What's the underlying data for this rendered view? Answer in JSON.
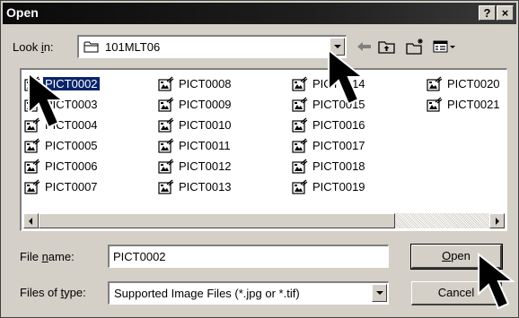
{
  "window": {
    "title": "Open",
    "help_label": "?",
    "close_label": "×"
  },
  "lookin": {
    "label_pre": "Look ",
    "label_ul": "i",
    "label_post": "n:",
    "value": "101MLT06"
  },
  "toolbar": {
    "back_icon": "back-arrow-icon",
    "up_icon": "up-one-level-icon",
    "new_folder_icon": "new-folder-icon",
    "view_icon": "view-menu-icon"
  },
  "files": [
    [
      "PICT0002",
      "PICT0003",
      "PICT0004",
      "PICT0005",
      "PICT0006",
      "PICT0007"
    ],
    [
      "PICT0008",
      "PICT0009",
      "PICT0010",
      "PICT0011",
      "PICT0012",
      "PICT0013"
    ],
    [
      "PICT0014",
      "PICT0015",
      "PICT0016",
      "PICT0017",
      "PICT0018",
      "PICT0019"
    ],
    [
      "PICT0020",
      "PICT0021"
    ]
  ],
  "selected_file": "PICT0002",
  "filename": {
    "label_pre": "File ",
    "label_ul": "n",
    "label_post": "ame:",
    "value": "PICT0002"
  },
  "filetype": {
    "label_pre": "Files of ",
    "label_ul": "t",
    "label_post": "ype:",
    "value": "Supported Image Files (*.jpg or *.tif)"
  },
  "buttons": {
    "open_ul": "O",
    "open_rest": "pen",
    "cancel": "Cancel"
  },
  "colors": {
    "face": "#d4d0c8",
    "selection": "#0a246a"
  }
}
